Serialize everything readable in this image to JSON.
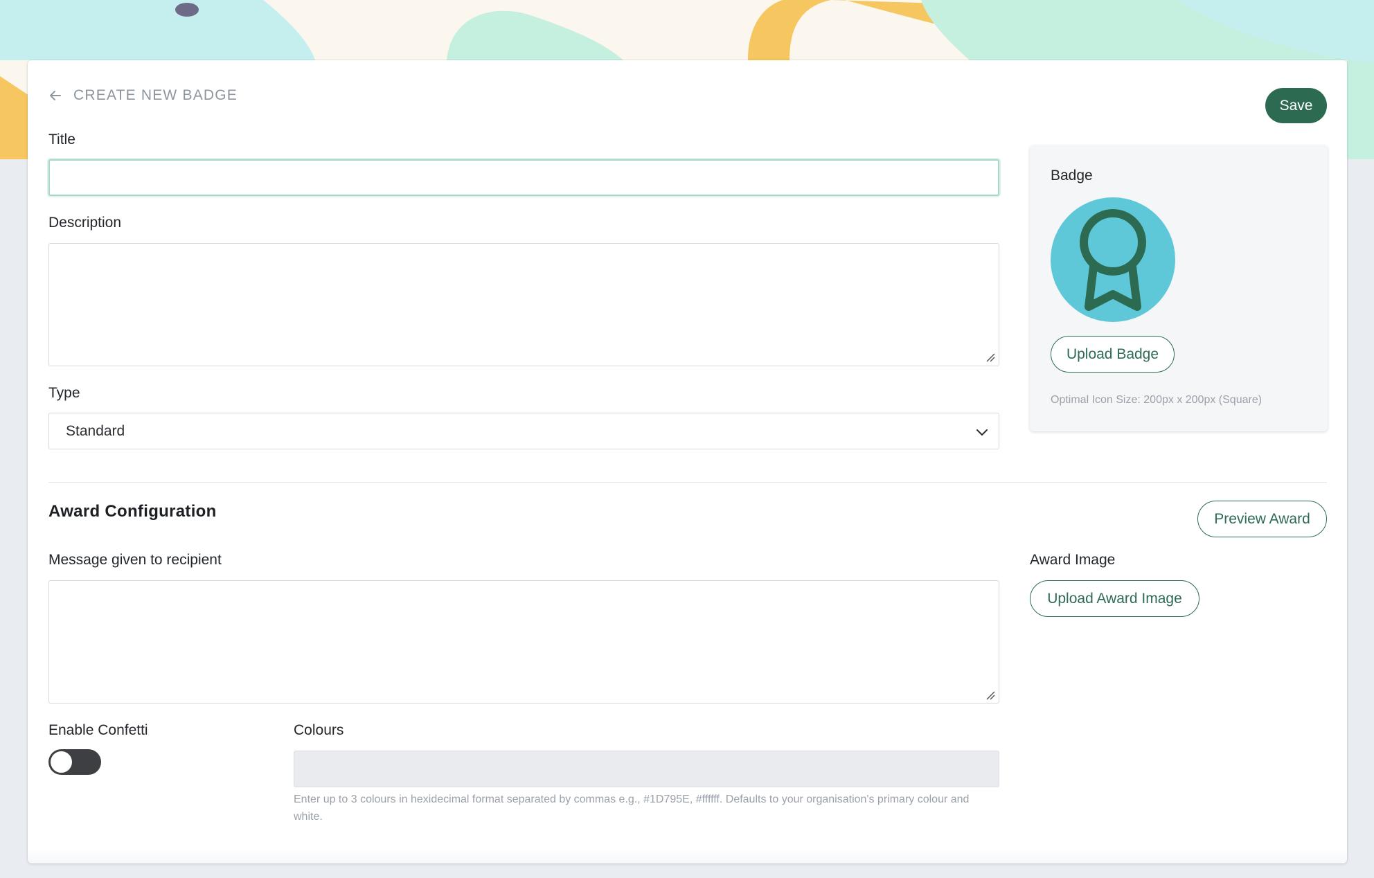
{
  "header": {
    "back_icon": "arrow-left-icon",
    "title": "CREATE NEW BADGE",
    "save_label": "Save"
  },
  "form": {
    "title_label": "Title",
    "title_value": "",
    "description_label": "Description",
    "description_value": "",
    "type_label": "Type",
    "type_value": "Standard"
  },
  "badge_panel": {
    "label": "Badge",
    "icon": "award-ribbon-icon",
    "upload_label": "Upload Badge",
    "hint": "Optimal Icon Size: 200px x 200px (Square)"
  },
  "award": {
    "section_title": "Award Configuration",
    "preview_label": "Preview Award",
    "message_label": "Message given to recipient",
    "message_value": "",
    "image_label": "Award Image",
    "upload_image_label": "Upload Award Image",
    "confetti_label": "Enable Confetti",
    "confetti_enabled": false,
    "colours_label": "Colours",
    "colours_value": "",
    "colours_hint": "Enter up to 3 colours in hexidecimal format separated by commas e.g., #1D795E, #ffffff. Defaults to your organisation's primary colour and white."
  },
  "colors": {
    "primary": "#2d6a52",
    "badge_bg": "#5ec8d8",
    "page_bg": "#e9ecf1"
  }
}
